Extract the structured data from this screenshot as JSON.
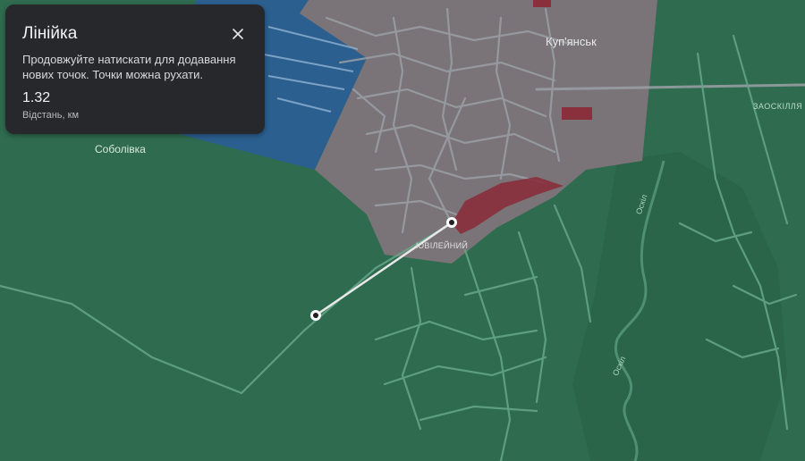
{
  "ruler": {
    "title": "Лінійка",
    "hint": "Продовжуйте натискати для додавання нових точок. Точки можна рухати.",
    "distance_value": "1.32",
    "distance_label": "Відстань, км",
    "close_icon": "close-icon"
  },
  "map_labels": {
    "city": "Куп'янськ",
    "sobolivka": "Соболівка",
    "zaoskillia": "ЗАОСКІЛЛЯ",
    "yuvileinyi": "ЮВІЛЕЙНИЙ",
    "river_1": "Оскіл",
    "river_2": "Оскіл"
  },
  "colors": {
    "green_zone": "#2f6b4f",
    "blue_zone": "#2b5f8f",
    "gray_zone": "#7a7478",
    "red_zone": "#8a2f3c",
    "ruler_line": "#e8e8e8",
    "panel_bg": "#26282c"
  }
}
